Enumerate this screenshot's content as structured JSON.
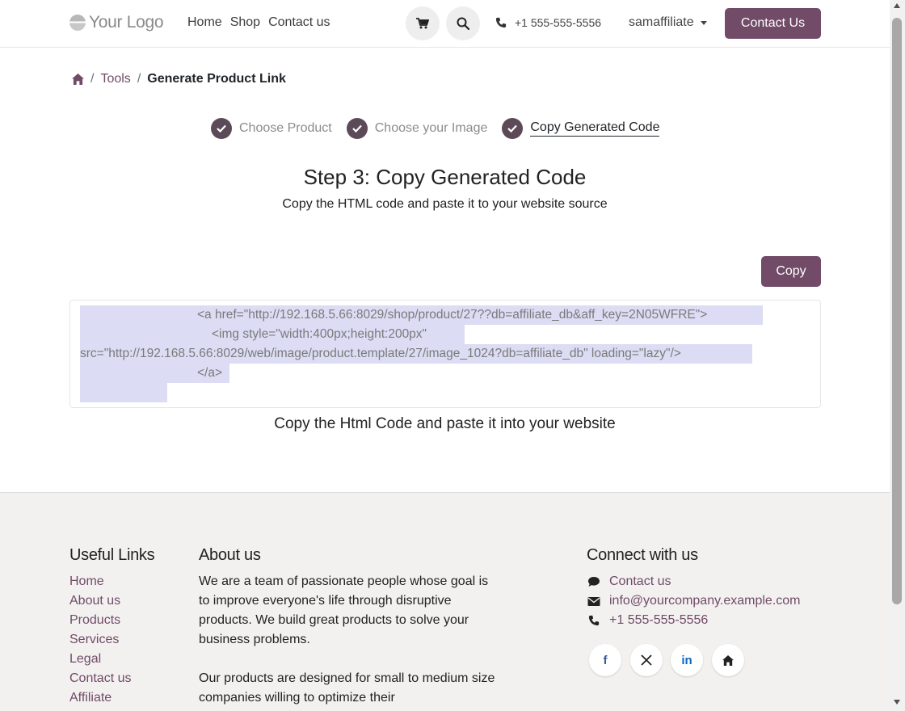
{
  "header": {
    "logo_text": "Your Logo",
    "nav": [
      "Home",
      "Shop",
      "Contact us"
    ],
    "phone": "+1 555-555-5556",
    "user": "samaffiliate",
    "contact_button": "Contact Us"
  },
  "breadcrumb": {
    "tools": "Tools",
    "current": "Generate Product Link"
  },
  "steps": [
    {
      "label": "Choose Product",
      "active": false
    },
    {
      "label": "Choose your Image",
      "active": false
    },
    {
      "label": "Copy Generated Code",
      "active": true
    }
  ],
  "main": {
    "title": "Step 3: Copy Generated Code",
    "subtitle": "Copy the HTML code and paste it to your website source",
    "copy_button": "Copy",
    "code_lines": [
      "<a href=\"http://192.168.5.66:8029/shop/product/27??db=affiliate_db&aff_key=2N05WFRE\">",
      "<img style=\"width:400px;height:200px\"",
      "src=\"http://192.168.5.66:8029/web/image/product.template/27/image_1024?db=affiliate_db\" loading=\"lazy\"/>",
      "</a>"
    ],
    "caption": "Copy the Html Code and paste it into your website"
  },
  "footer": {
    "useful_links_title": "Useful Links",
    "useful_links": [
      "Home",
      "About us",
      "Products",
      "Services",
      "Legal",
      "Contact us",
      "Affiliate"
    ],
    "about_title": "About us",
    "about_p1": "We are a team of passionate people whose goal is to improve everyone's life through disruptive products. We build great products to solve your business problems.",
    "about_p2": "Our products are designed for small to medium size companies willing to optimize their",
    "connect_title": "Connect with us",
    "connect_contact": "Contact us",
    "connect_email": "info@yourcompany.example.com",
    "connect_phone": "+1 555-555-5556",
    "social_icons": [
      "facebook-icon",
      "x-twitter-icon",
      "linkedin-icon",
      "home-icon"
    ]
  },
  "colors": {
    "brand": "#714b67",
    "step_check": "#5d4a59",
    "selection": "#dcdcf4",
    "footer_bg": "#f2f1f0"
  }
}
